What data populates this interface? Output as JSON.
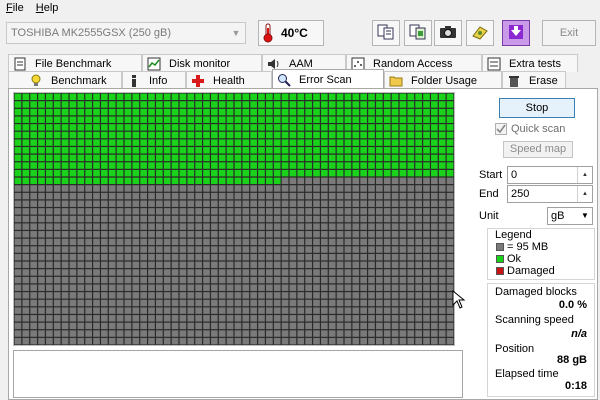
{
  "menu": [
    {
      "underline": "F",
      "rest": "ile"
    },
    {
      "underline": "H",
      "rest": "elp"
    }
  ],
  "toolbar": {
    "drive": "TOSHIBA MK2555GSX (250 gB)",
    "temperature": "40°C",
    "exit_label": "Exit",
    "icons": [
      "copy-text-icon",
      "copy-info-icon",
      "screenshot-camera-icon",
      "save-icon",
      "download-icon"
    ]
  },
  "tabs_row1": [
    {
      "label": "File Benchmark",
      "icon": "file-benchmark-icon"
    },
    {
      "label": "Disk monitor",
      "icon": "disk-monitor-icon"
    },
    {
      "label": "AAM",
      "icon": "speaker-icon"
    },
    {
      "label": "Random Access",
      "icon": "random-access-icon"
    },
    {
      "label": "Extra tests",
      "icon": "extra-tests-icon"
    }
  ],
  "tabs_row2": [
    {
      "label": "Benchmark",
      "icon": "lightbulb-icon"
    },
    {
      "label": "Info",
      "icon": "info-icon"
    },
    {
      "label": "Health",
      "icon": "health-cross-icon"
    },
    {
      "label": "Error Scan",
      "icon": "magnifier-icon",
      "active": true
    },
    {
      "label": "Folder Usage",
      "icon": "folder-icon"
    },
    {
      "label": "Erase",
      "icon": "trash-icon"
    }
  ],
  "scan": {
    "stop_label": "Stop",
    "quick_scan_label": "Quick scan",
    "quick_scan_checked": true,
    "speed_map_label": "Speed map",
    "start_label": "Start",
    "start_value": "0",
    "end_label": "End",
    "end_value": "250",
    "unit_label": "Unit",
    "unit_value": "gB"
  },
  "legend": {
    "title": "Legend",
    "items": [
      {
        "label": "= 95 MB",
        "color": "#7a7a7a"
      },
      {
        "label": "Ok",
        "color": "#19d219"
      },
      {
        "label": "Damaged",
        "color": "#c81414"
      }
    ]
  },
  "stats": {
    "damaged_label": "Damaged blocks",
    "damaged_value": "0.0 %",
    "speed_label": "Scanning speed",
    "speed_value": "n/a",
    "position_label": "Position",
    "position_value": "88 gB",
    "elapsed_label": "Elapsed time",
    "elapsed_value": "0:18"
  },
  "block_grid": {
    "columns": 56,
    "rows": 33,
    "ok_color": "#19d219",
    "pending_color": "#7a7a7a",
    "scanned_progress": 0.352
  }
}
